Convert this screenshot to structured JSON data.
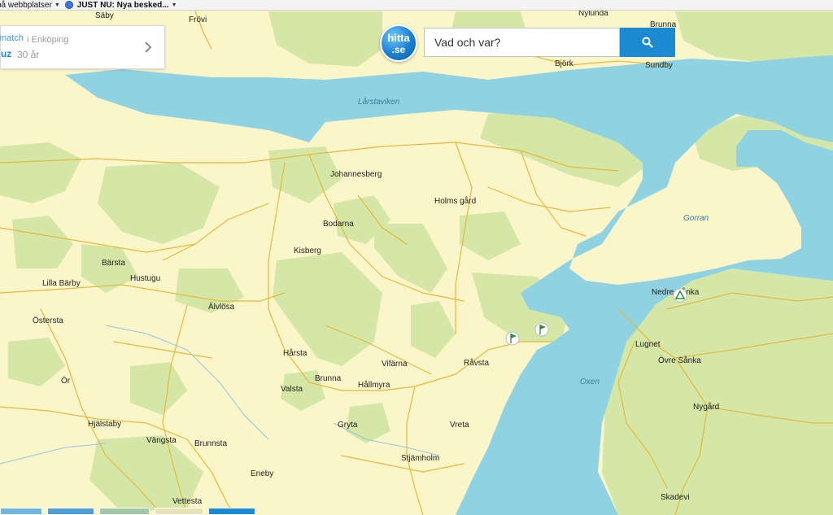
{
  "browser": {
    "bookmarks": [
      {
        "label": "på webbplatser",
        "bold": false
      },
      {
        "label": "JUST NU: Nya besked...",
        "bold": true
      }
    ]
  },
  "search": {
    "logo_line1": "hitta",
    "logo_line2": ".se",
    "placeholder": "Vad och var?",
    "button_icon": "search-icon"
  },
  "profile_card": {
    "brand": "match",
    "location": "i Enköping",
    "name": "uz",
    "age": "30 år",
    "chevron_icon": "chevron-right-icon"
  },
  "map": {
    "places": {
      "saby": "Säby",
      "frovi": "Frövi",
      "nylunda": "Nylunda",
      "brunna_n": "Brunna",
      "bjork": "Björk",
      "sundby": "Sundby",
      "johannesberg": "Johannesberg",
      "holms_gard": "Holms gård",
      "bodarna": "Bodarna",
      "kisberg": "Kisberg",
      "barsta": "Bärsta",
      "lilla_barby": "Lilla Bärby",
      "hustugu": "Hustugu",
      "alvlosa": "Älvlösa",
      "ostersta": "Östersta",
      "or": "Ör",
      "harsta": "Hårsta",
      "vifarna": "Vifärna",
      "ravsta": "Råvsta",
      "brunna_s": "Brunna",
      "valsta": "Valsta",
      "hallmyra": "Hållmyra",
      "gryta": "Gryta",
      "vreta": "Vreta",
      "hjalstaby": "Hjälstaby",
      "vangsta": "Vängsta",
      "brunnsta": "Brunnsta",
      "stjamholm": "Stjämholm",
      "eneby": "Eneby",
      "vettesta": "Vettesta",
      "nedre_sanka": "Nedre Sånka",
      "lugnet": "Lugnet",
      "ovre_sanka": "Övre Sånka",
      "nygard": "Nygård",
      "skadevi": "Skadevi"
    },
    "water": {
      "larstaviken": "Lårstaviken",
      "gorran": "Gorran",
      "oxen": "Oxen"
    },
    "colors": {
      "land": "#fbf6c9",
      "forest": "#d4e7a6",
      "water": "#8fd3e2",
      "road": "#e6b83a",
      "accent": "#1c8ad2"
    }
  }
}
